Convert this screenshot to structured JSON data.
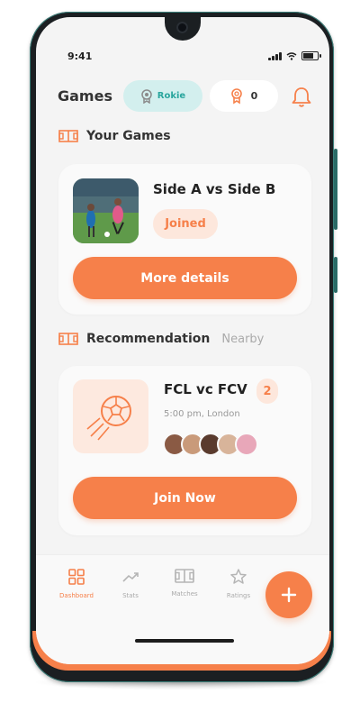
{
  "colors": {
    "accent": "#f6804a",
    "rank_bg": "#d3efee",
    "rank_text": "#29a59d"
  },
  "status_bar": {
    "time": "9:41"
  },
  "header": {
    "title": "Games",
    "rank_label": "Rokie",
    "rank_icon": "medal-icon",
    "medal_count": "0",
    "medal_icon": "award-icon",
    "notifications_icon": "bell-icon"
  },
  "your_games": {
    "section_label": "Your Games",
    "section_icon": "pitch-icon",
    "card": {
      "title": "Side A vs Side B",
      "status": "Joined",
      "button_label": "More details"
    }
  },
  "recommendation": {
    "section_label": "Recommendation",
    "filter_label": "Nearby",
    "section_icon": "pitch-icon",
    "card": {
      "title": "FCL vc FCV",
      "count": "2",
      "meta": "5:00 pm, London",
      "icon": "football-icon",
      "button_label": "Join Now"
    }
  },
  "bottom_nav": {
    "items": [
      {
        "label": "Dashboard",
        "icon": "grid-icon",
        "active": true
      },
      {
        "label": "Stats",
        "icon": "trend-icon",
        "active": false
      },
      {
        "label": "Matches",
        "icon": "pitch-icon",
        "active": false
      },
      {
        "label": "Ratings",
        "icon": "star-icon",
        "active": false
      }
    ],
    "fab_icon": "plus-icon"
  }
}
